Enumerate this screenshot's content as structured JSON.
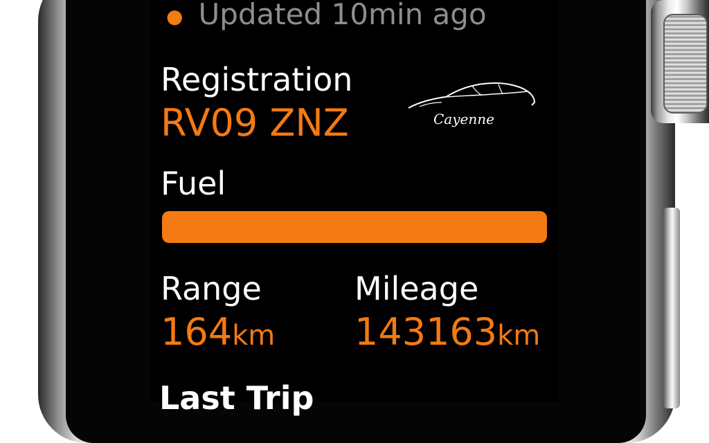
{
  "status": {
    "updated_text": "Updated 10min ago",
    "dot_color": "#f47a13"
  },
  "vehicle": {
    "registration_label": "Registration",
    "registration_value": "RV09 ZNZ",
    "model_logo_text": "Cayenne"
  },
  "fuel": {
    "label": "Fuel",
    "level_fraction": 1.0
  },
  "stats": {
    "range_label": "Range",
    "range_value": "164",
    "range_unit": "km",
    "mileage_label": "Mileage",
    "mileage_value": "143163",
    "mileage_unit": "km"
  },
  "section": {
    "last_trip_label": "Last Trip"
  },
  "colors": {
    "accent": "#f47a13",
    "background": "#000000",
    "text": "#ffffff",
    "muted": "#8e8e8e"
  }
}
